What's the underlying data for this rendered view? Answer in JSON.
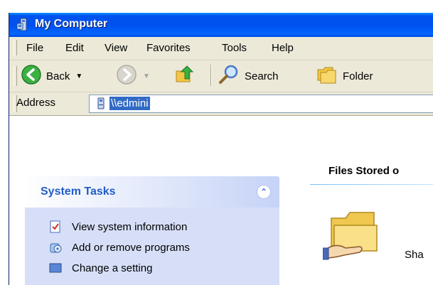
{
  "window": {
    "title": "My Computer"
  },
  "menubar": {
    "items": [
      {
        "label": "File"
      },
      {
        "label": "Edit"
      },
      {
        "label": "View"
      },
      {
        "label": "Favorites"
      },
      {
        "label": "Tools"
      },
      {
        "label": "Help"
      }
    ]
  },
  "toolbar": {
    "back_label": "Back",
    "search_label": "Search",
    "folders_label": "Folder"
  },
  "address": {
    "label": "Address",
    "value": "\\\\edmini"
  },
  "tasks": {
    "title": "System Tasks",
    "collapse_icon": "chevron-up-double",
    "items": [
      {
        "label": "View system information",
        "icon": "system-info-icon"
      },
      {
        "label": "Add or remove programs",
        "icon": "add-remove-programs-icon"
      },
      {
        "label": "Change a setting",
        "icon": "control-panel-icon"
      }
    ]
  },
  "files": {
    "heading": "Files Stored o",
    "folders": [
      {
        "label": "Sha"
      }
    ]
  },
  "colors": {
    "titlebar": "#0054e3",
    "panel_header_text": "#215dc6",
    "address_selection": "#316ac5",
    "task_pane_bg": "#d6dff7"
  }
}
